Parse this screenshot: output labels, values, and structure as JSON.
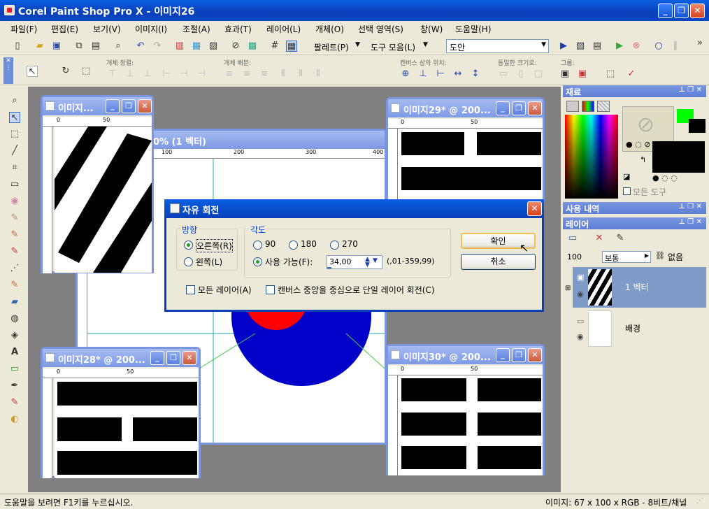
{
  "app": {
    "title": "Corel Paint Shop Pro X - 이미지26"
  },
  "menu": [
    "파일(F)",
    "편집(E)",
    "보기(V)",
    "이미지(I)",
    "조절(A)",
    "효과(T)",
    "레이어(L)",
    "개체(O)",
    "선택 영역(S)",
    "창(W)",
    "도움말(H)"
  ],
  "toolbar": {
    "palette_label": "팔레트(P)",
    "toolset_label": "도구 모음(L)",
    "preset": "도안"
  },
  "toolbar2": {
    "group_align": "개체 정렬:",
    "group_distribute": "개체 배분:",
    "group_canvas_pos": "캔버스 상의 위치:",
    "group_same_size": "동일한 크기로:",
    "group_group": "그룹:"
  },
  "windows": {
    "w_main": {
      "title": "0% (1 벡터)"
    },
    "w_left": {
      "title": "이미지...",
      "ruler_marks": [
        "0",
        "50"
      ]
    },
    "w29": {
      "title": "이미지29* @ 200...",
      "ruler_marks": [
        "0",
        "50"
      ]
    },
    "w28": {
      "title": "이미지28* @ 200...",
      "ruler_marks": [
        "0",
        "50"
      ]
    },
    "w30": {
      "title": "이미지30* @ 200...",
      "ruler_marks": [
        "0",
        "50"
      ]
    },
    "main_ruler": [
      "100",
      "200",
      "300",
      "400"
    ]
  },
  "dialog": {
    "title": "자유 회전",
    "direction_label": "방향",
    "right": "오른쪽(R)",
    "left": "왼쪽(L)",
    "angle_label": "각도",
    "a90": "90",
    "a180": "180",
    "a270": "270",
    "free": "사용 가능(F):",
    "value": "34,00",
    "range": "(,01-359,99)",
    "all_layers": "모든 레이어(A)",
    "canvas_center": "캔버스 중앙을 중심으로 단일 레이어 회전(C)",
    "ok": "확인",
    "cancel": "취소"
  },
  "panels": {
    "materials": "재료",
    "all_tools": "모든 도구",
    "history": "사용 내역",
    "layers": "레이어",
    "opacity": "100",
    "blend": "보통",
    "none": "없음",
    "layer1": "1 벡터",
    "layer2": "배경"
  },
  "status": {
    "help": "도움말을 보려면 F1키를 누르십시오.",
    "info": "이미지:  67 x 100 x RGB - 8비트/채널"
  },
  "colors": {
    "title_blue": "#0a47c6",
    "fg": "#00ff00",
    "bg": "#000000",
    "circle_blue": "#0000c8",
    "circle_red": "#ff0000"
  }
}
